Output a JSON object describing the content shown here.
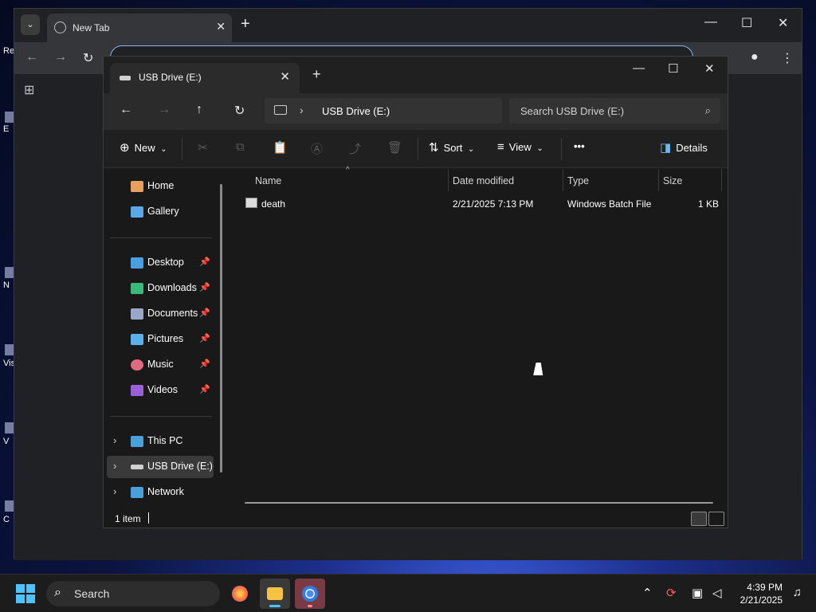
{
  "desktop": {
    "labels": [
      "Re",
      "E",
      "N",
      "Vis",
      "V",
      "C"
    ]
  },
  "chrome": {
    "tab_title": "New Tab",
    "menu_glyph": "⌄",
    "close_glyph": "✕",
    "newtab_glyph": "+",
    "minimize_glyph": "—",
    "maximize_glyph": "☐",
    "window_close_glyph": "✕",
    "back_glyph": "←",
    "forward_glyph": "→",
    "reload_glyph": "↻",
    "apps_glyph": "⊞",
    "profile_glyph": "●",
    "more_glyph": "⋮"
  },
  "explorer": {
    "tab_title": "USB Drive (E:)",
    "tab_close_glyph": "✕",
    "newtab_glyph": "+",
    "minimize_glyph": "—",
    "maximize_glyph": "☐",
    "close_glyph": "✕",
    "nav": {
      "back": "←",
      "forward": "→",
      "up": "↑",
      "refresh": "↻"
    },
    "address": {
      "chevron": "›",
      "crumb": "USB Drive (E:)"
    },
    "search": {
      "placeholder": "Search USB Drive (E:)",
      "icon": "⌕"
    },
    "commands": {
      "new_label": "New",
      "new_icon": "⊕",
      "sort_label": "Sort",
      "sort_icon": "⇅",
      "view_label": "View",
      "view_icon": "≡",
      "more_label": "•••",
      "details_label": "Details",
      "details_icon": "◨",
      "cut_icon": "✂",
      "copy_icon": "⧉",
      "paste_icon": "📋",
      "rename_icon": "Ⓐ",
      "share_icon": "⤴",
      "delete_icon": "🗑",
      "dropdown_caret": "⌄"
    },
    "nav_pane": {
      "quick": [
        {
          "label": "Home",
          "icon": "home-icon",
          "color": "#e8a060"
        },
        {
          "label": "Gallery",
          "icon": "gallery-icon",
          "color": "#5aa8e8"
        }
      ],
      "pinned": [
        {
          "label": "Desktop",
          "icon": "desktop-icon",
          "color": "#4a9fe0"
        },
        {
          "label": "Downloads",
          "icon": "downloads-icon",
          "color": "#3cb878"
        },
        {
          "label": "Documents",
          "icon": "documents-icon",
          "color": "#9aa8c8"
        },
        {
          "label": "Pictures",
          "icon": "pictures-icon",
          "color": "#5ab0e8"
        },
        {
          "label": "Music",
          "icon": "music-icon",
          "color": "#e06a80"
        },
        {
          "label": "Videos",
          "icon": "videos-icon",
          "color": "#9a60d8"
        }
      ],
      "pin_glyph": "📌",
      "tree": [
        {
          "label": "This PC",
          "icon": "this-pc-icon",
          "color": "#4aa0d8"
        },
        {
          "label": "USB Drive (E:)",
          "icon": "usb-drive-icon",
          "color": "#d0d0d0"
        },
        {
          "label": "Network",
          "icon": "network-icon",
          "color": "#4aa0d8"
        }
      ],
      "expand_glyph": "›"
    },
    "columns": {
      "name": "Name",
      "date": "Date modified",
      "type": "Type",
      "size": "Size",
      "sort_caret": "^"
    },
    "files": [
      {
        "name": "death",
        "date": "2/21/2025 7:13 PM",
        "type": "Windows Batch File",
        "size": "1 KB"
      }
    ],
    "status": {
      "count": "1 item"
    }
  },
  "taskbar": {
    "search_label": "Search",
    "search_icon": "⌕",
    "tray_chevron": "⌃",
    "time": "4:39 PM",
    "date": "2/21/2025",
    "bell": "🔔"
  },
  "colors": {
    "accent": "#4cc2ff",
    "explorer_bg": "#191919",
    "selected_nav": "#3a3a3a"
  }
}
